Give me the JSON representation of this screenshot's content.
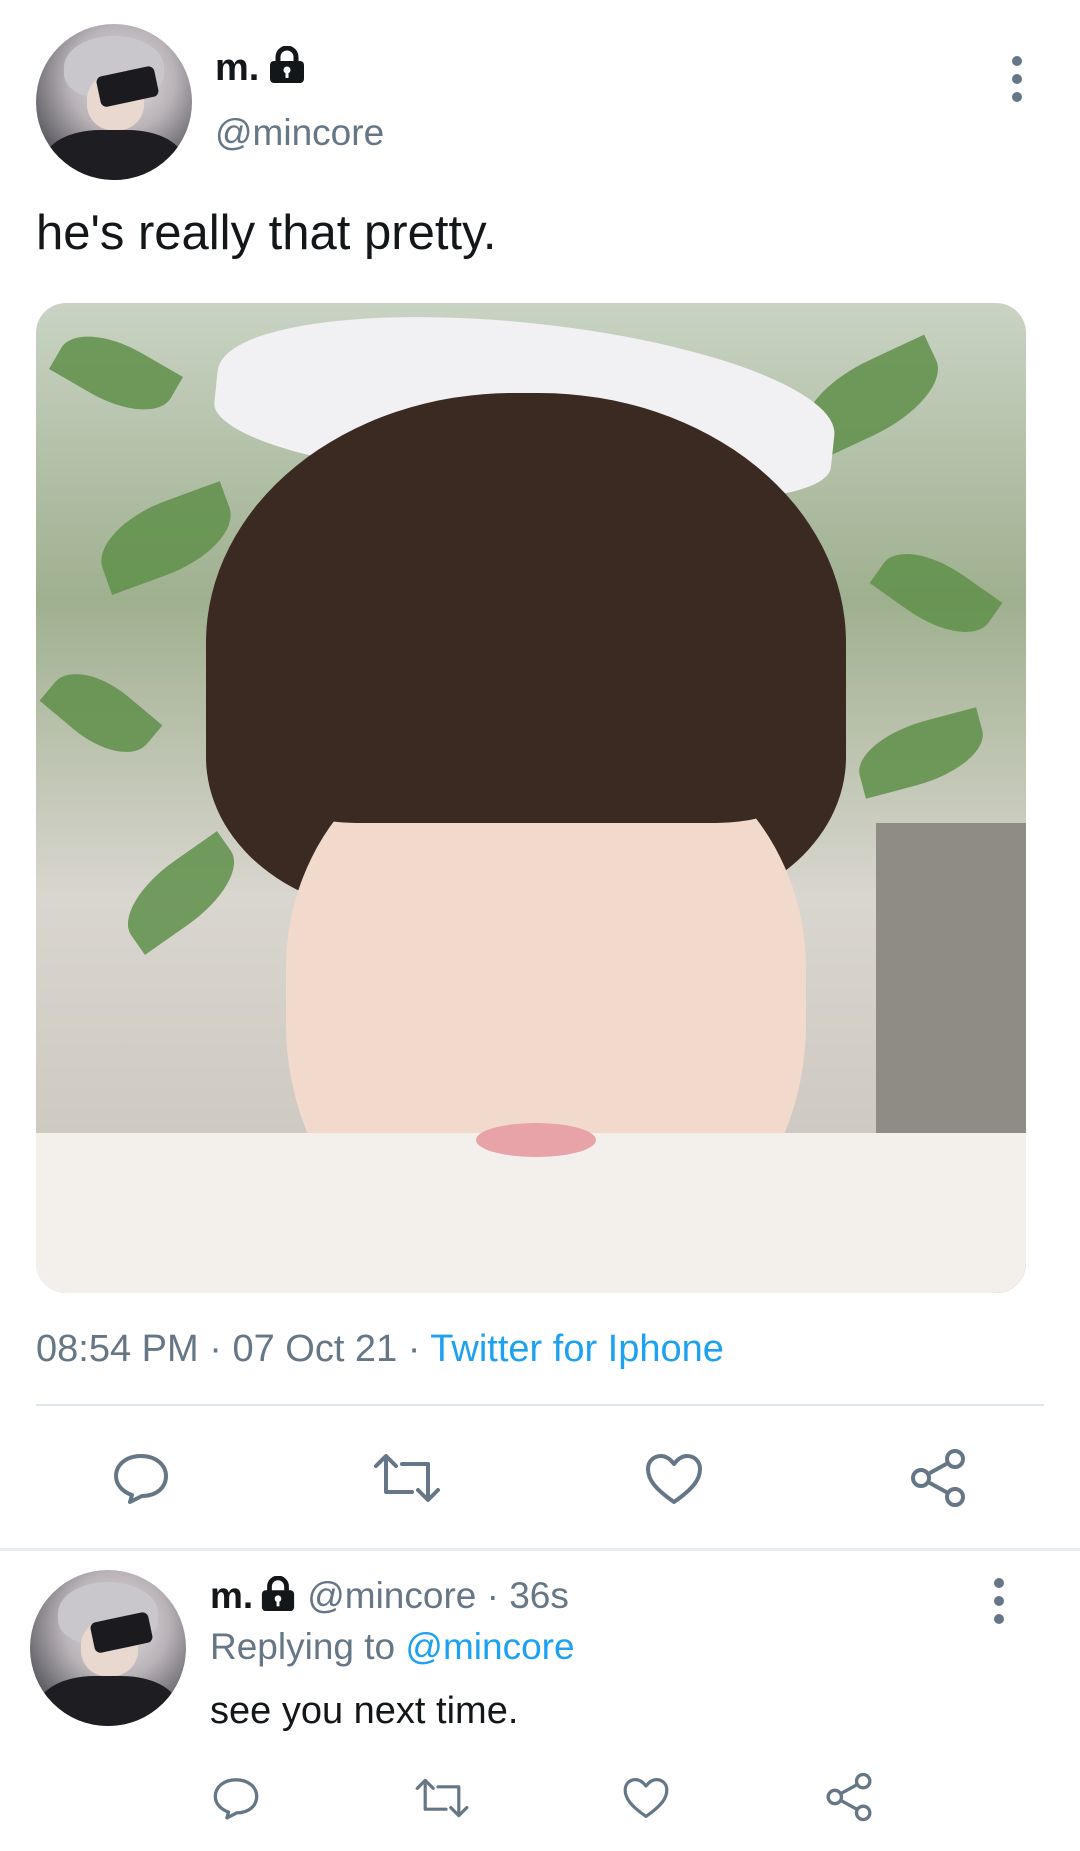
{
  "main_tweet": {
    "display_name": "m.",
    "handle": "@mincore",
    "text": "he's really that pretty.",
    "time": "08:54 PM",
    "date": "07 Oct 21",
    "source": "Twitter for Iphone",
    "separator": "·"
  },
  "reply_tweet": {
    "display_name": "m.",
    "handle": "@mincore",
    "age": "36s",
    "replying_prefix": "Replying to",
    "replying_to": "@mincore",
    "text": "see you next time.",
    "separator": "·"
  },
  "colors": {
    "text": "#14171a",
    "secondary": "#657786",
    "link": "#1da1f2",
    "divider": "#e1e8ed"
  },
  "icons": [
    "lock-icon",
    "more-icon",
    "reply-icon",
    "retweet-icon",
    "like-icon",
    "share-icon"
  ]
}
